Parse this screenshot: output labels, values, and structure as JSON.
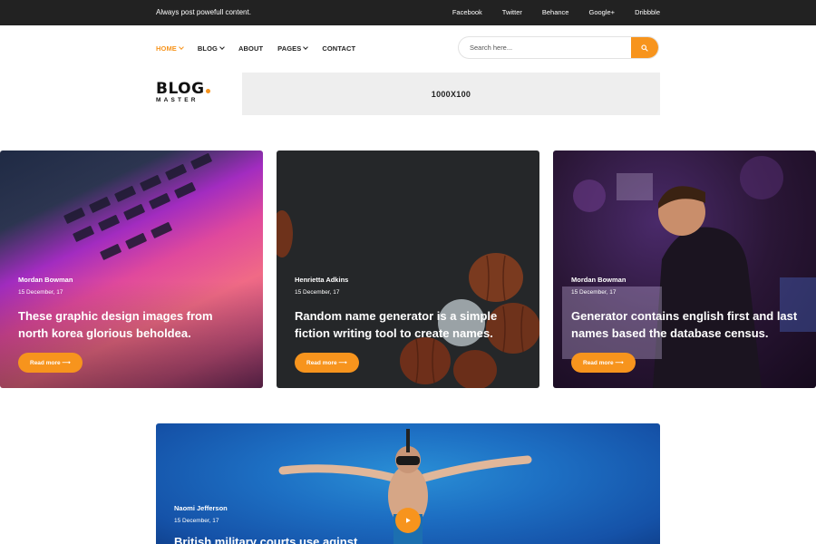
{
  "topbar": {
    "tagline": "Always post powefull content.",
    "social": [
      "Facebook",
      "Twitter",
      "Behance",
      "Google+",
      "Dribbble"
    ]
  },
  "nav": {
    "items": [
      {
        "label": "HOME",
        "dropdown": true,
        "active": true
      },
      {
        "label": "BLOG",
        "dropdown": true,
        "active": false
      },
      {
        "label": "ABOUT",
        "dropdown": false,
        "active": false
      },
      {
        "label": "PAGES",
        "dropdown": true,
        "active": false
      },
      {
        "label": "CONTACT",
        "dropdown": false,
        "active": false
      }
    ]
  },
  "search": {
    "placeholder": "Search here...",
    "icon": "search-icon"
  },
  "logo": {
    "line1": "BLOG",
    "line2": "MASTER"
  },
  "ad": {
    "label": "1000X100"
  },
  "posts": [
    {
      "author": "Mordan Bowman",
      "date": "15 December, 17",
      "title": "These graphic design images from north korea glorious beholdea.",
      "button": "Read more ⟶"
    },
    {
      "author": "Henrietta Adkins",
      "date": "15 December, 17",
      "title": "Random name generator is a simple fiction writing tool to create names.",
      "button": "Read more ⟶"
    },
    {
      "author": "Mordan Bowman",
      "date": "15 December, 17",
      "title": "Generator contains english first and last names based the database census.",
      "button": "Read more ⟶"
    }
  ],
  "featured": {
    "author": "Naomi Jefferson",
    "date": "15 December, 17",
    "title": "British military courts use aginst",
    "icon": "play-icon"
  },
  "colors": {
    "accent": "#f7941d",
    "topbar": "#222222",
    "ad_bg": "#eeeeee"
  }
}
